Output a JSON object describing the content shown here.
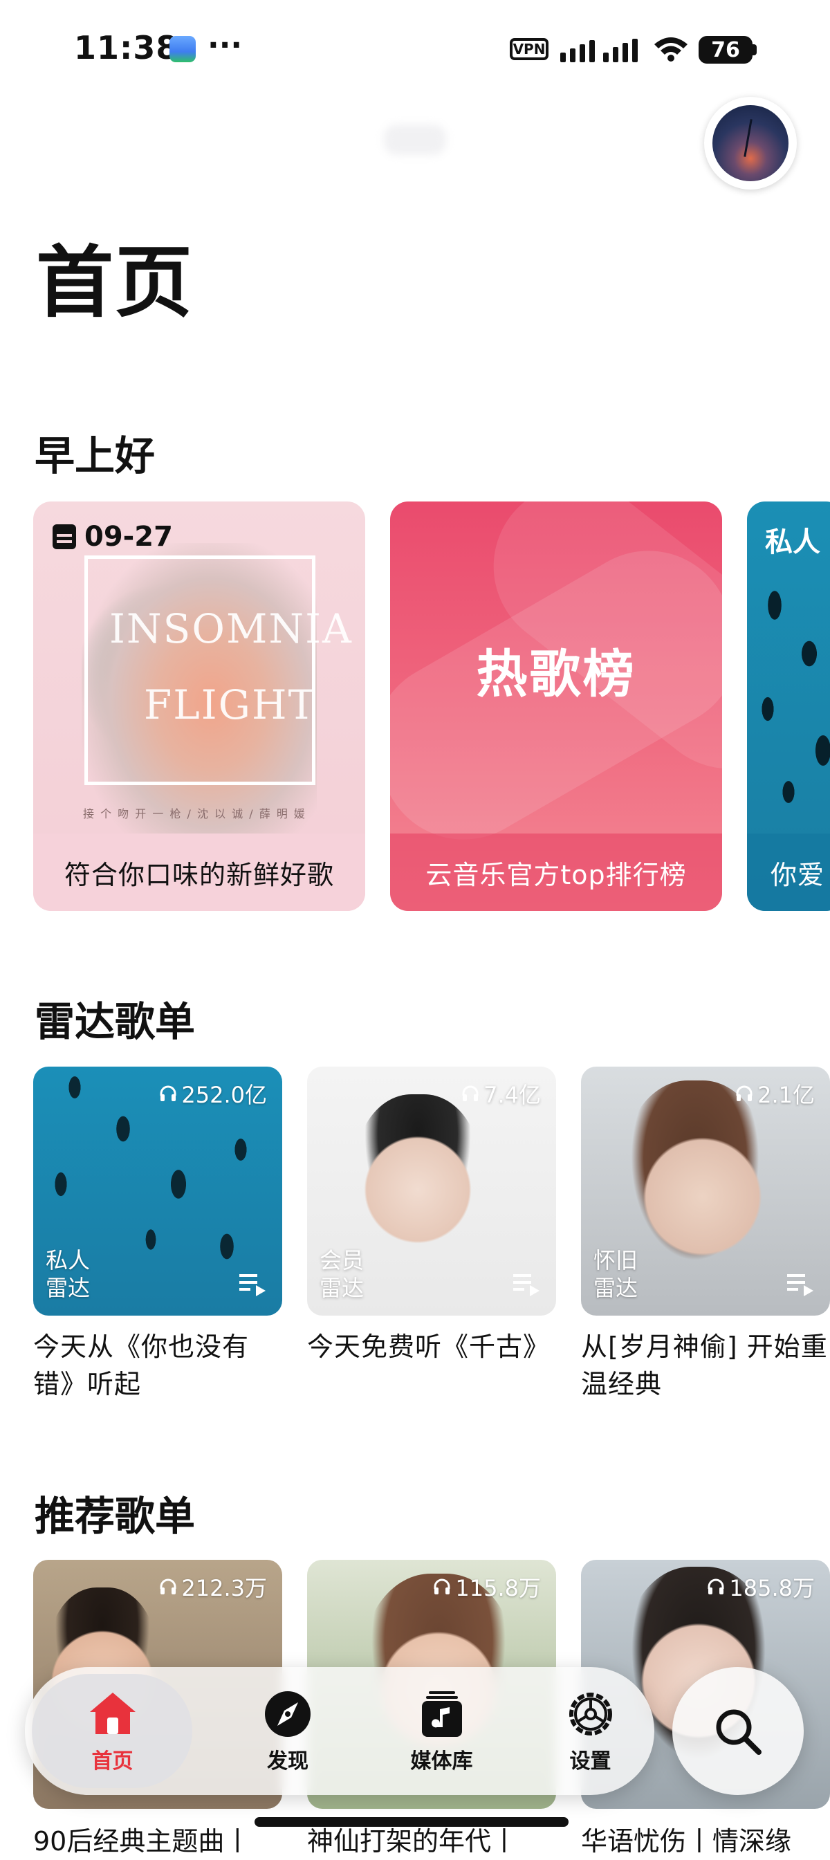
{
  "status_bar": {
    "time": "11:38",
    "dots": "···",
    "vpn": "VPN",
    "battery": "76"
  },
  "header": {
    "title": "首页"
  },
  "greeting": {
    "title": "早上好",
    "cards": [
      {
        "date": "09-27",
        "art_line1": "INSOMNIA",
        "art_line2": "FLIGHT",
        "art_credit": "接 个 吻 开 一 枪 / 沈 以 诚 / 薛 明 媛",
        "caption": "符合你口味的新鲜好歌"
      },
      {
        "title": "热歌榜",
        "caption": "云音乐官方top排行榜"
      },
      {
        "tag": "私人",
        "caption": "你爱"
      }
    ]
  },
  "radar": {
    "title": "雷达歌单",
    "items": [
      {
        "plays": "252.0亿",
        "label_line1": "私人",
        "label_line2": "雷达",
        "caption": "今天从《你也没有错》听起"
      },
      {
        "plays": "7.4亿",
        "label_line1": "会员",
        "label_line2": "雷达",
        "caption": "今天免费听《千古》"
      },
      {
        "plays": "2.1亿",
        "label_line1": "怀旧",
        "label_line2": "雷达",
        "caption": "从[岁月神偷] 开始重温经典"
      }
    ]
  },
  "recommended": {
    "title": "推荐歌单",
    "items": [
      {
        "plays": "212.3万",
        "caption": "90后经典主题曲丨"
      },
      {
        "plays": "115.8万",
        "caption": "神仙打架的年代丨"
      },
      {
        "plays": "185.8万",
        "caption": "华语忧伤丨情深缘"
      }
    ]
  },
  "nav": {
    "home": "首页",
    "discover": "发现",
    "library": "媒体库",
    "settings": "设置"
  },
  "colors": {
    "accent": "#e8323c",
    "hot_chart": "#ea4b6d"
  }
}
